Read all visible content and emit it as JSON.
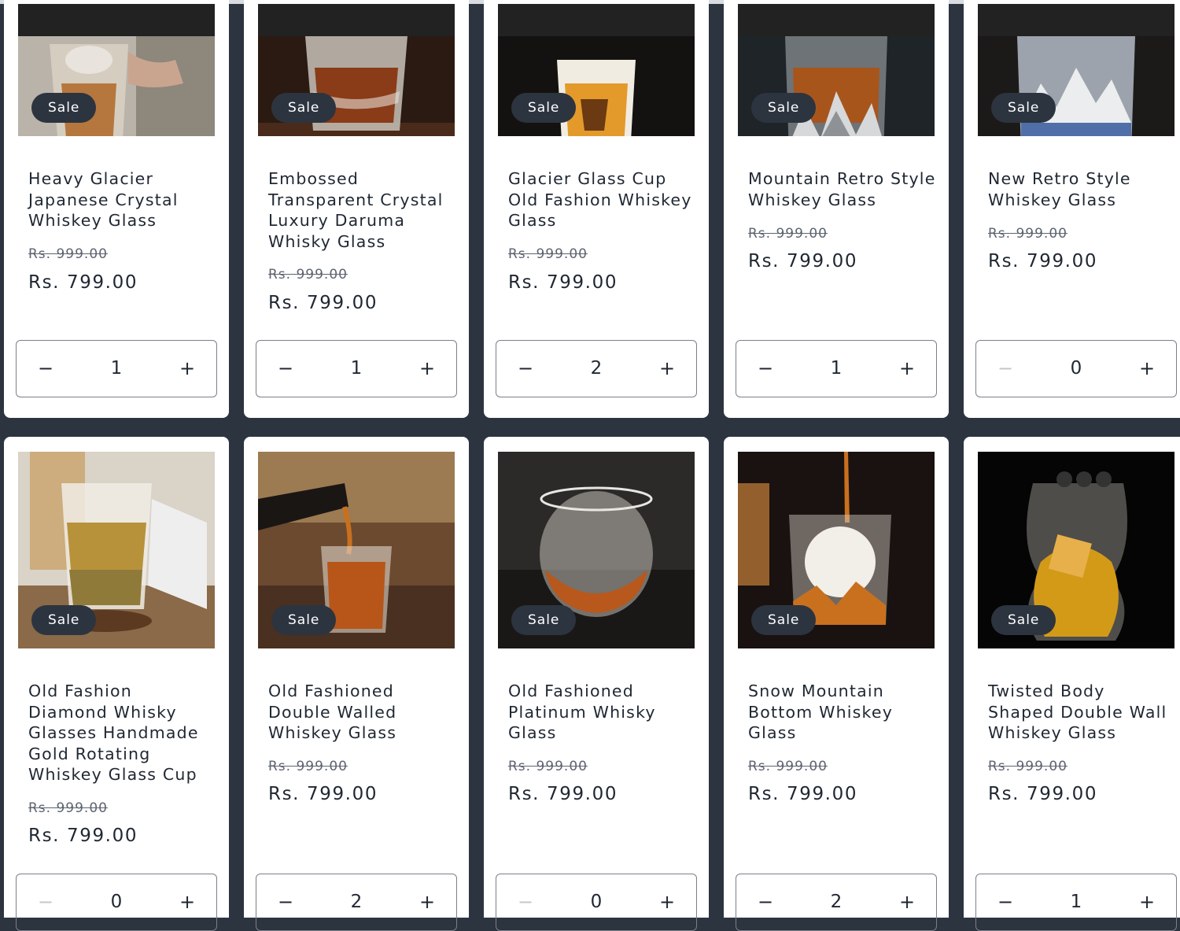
{
  "currency_old_label": "Rs. 999.00",
  "products": [
    {
      "title": "Heavy Glacier Japanese Crystal Whiskey Glass",
      "badge": "Sale",
      "compare_price": "Rs. 999.00",
      "price": "Rs. 799.00",
      "qty": "1",
      "minus": "−",
      "plus": "+"
    },
    {
      "title": "Embossed Transparent Crystal Luxury Daruma Whisky Glass",
      "badge": "Sale",
      "compare_price": "Rs. 999.00",
      "price": "Rs. 799.00",
      "qty": "1",
      "minus": "−",
      "plus": "+"
    },
    {
      "title": "Glacier Glass Cup Old Fashion Whiskey Glass",
      "badge": "Sale",
      "compare_price": "Rs. 999.00",
      "price": "Rs. 799.00",
      "qty": "2",
      "minus": "−",
      "plus": "+"
    },
    {
      "title": "Mountain Retro Style Whiskey Glass",
      "badge": "Sale",
      "compare_price": "Rs. 999.00",
      "price": "Rs. 799.00",
      "qty": "1",
      "minus": "−",
      "plus": "+"
    },
    {
      "title": "New Retro Style Whiskey Glass",
      "badge": "Sale",
      "compare_price": "Rs. 999.00",
      "price": "Rs. 799.00",
      "qty": "0",
      "minus": "−",
      "plus": "+"
    },
    {
      "title": "Old Fashion Diamond Whisky Glasses Handmade Gold Rotating Whiskey Glass Cup",
      "badge": "Sale",
      "compare_price": "Rs. 999.00",
      "price": "Rs. 799.00",
      "qty": "0",
      "minus": "−",
      "plus": "+"
    },
    {
      "title": "Old Fashioned Double Walled Whiskey Glass",
      "badge": "Sale",
      "compare_price": "Rs. 999.00",
      "price": "Rs. 799.00",
      "qty": "2",
      "minus": "−",
      "plus": "+"
    },
    {
      "title": "Old Fashioned Platinum Whisky Glass",
      "badge": "Sale",
      "compare_price": "Rs. 999.00",
      "price": "Rs. 799.00",
      "qty": "0",
      "minus": "−",
      "plus": "+"
    },
    {
      "title": "Snow Mountain Bottom Whiskey Glass",
      "badge": "Sale",
      "compare_price": "Rs. 999.00",
      "price": "Rs. 799.00",
      "qty": "2",
      "minus": "−",
      "plus": "+"
    },
    {
      "title": "Twisted Body Shaped Double Wall Whiskey Glass",
      "badge": "Sale",
      "compare_price": "Rs. 999.00",
      "price": "Rs. 799.00",
      "qty": "1",
      "minus": "−",
      "plus": "+"
    }
  ]
}
